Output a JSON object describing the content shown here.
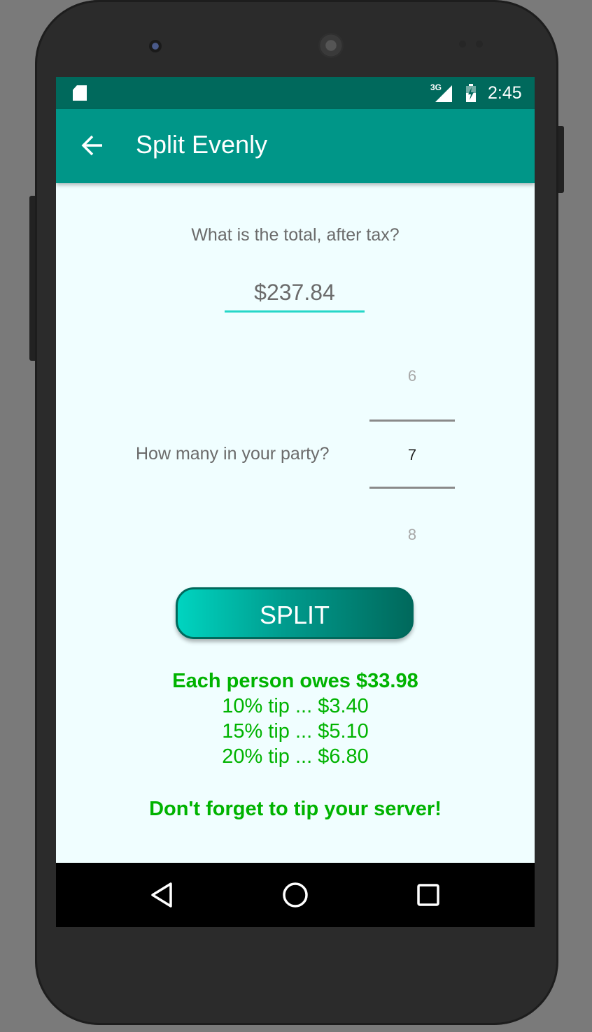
{
  "status_bar": {
    "network_label": "3G",
    "time": "2:45",
    "icons": [
      "sd-card-icon",
      "signal-icon",
      "battery-icon"
    ]
  },
  "app_bar": {
    "title": "Split Evenly",
    "back_icon": "arrow-back-icon",
    "color": "#009688",
    "status_color": "#00695c"
  },
  "form": {
    "total_question": "What is the total, after tax?",
    "total_value": "$237.84",
    "party_question": "How many in your party?",
    "party_picker": {
      "previous": "6",
      "selected": "7",
      "next": "8"
    }
  },
  "split_button": {
    "label": "SPLIT"
  },
  "results": {
    "each_person": "Each person owes $33.98",
    "tip_10": "10% tip ... $3.40",
    "tip_15": "15% tip ... $5.10",
    "tip_20": "20% tip ... $6.80",
    "reminder": "Don't forget to tip your server!",
    "color": "#00b300"
  },
  "nav_bar": {
    "icons": [
      "back-triangle-icon",
      "home-circle-icon",
      "recents-square-icon"
    ]
  }
}
